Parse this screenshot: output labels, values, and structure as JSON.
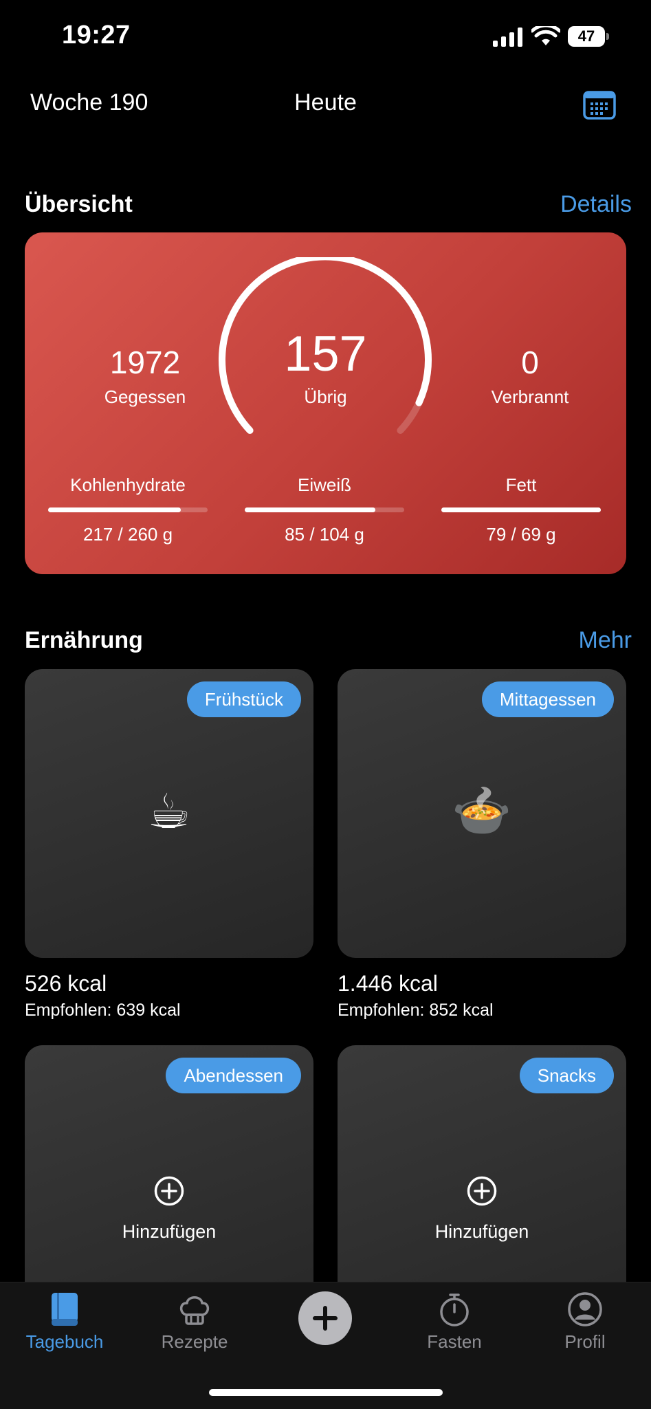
{
  "status_bar": {
    "time": "19:27",
    "battery": "47"
  },
  "header": {
    "week": "Woche 190",
    "title": "Heute",
    "calendar_icon": "calendar-icon"
  },
  "overview": {
    "title": "Übersicht",
    "link": "Details",
    "eaten_value": "1972",
    "eaten_label": "Gegessen",
    "remaining_value": "157",
    "remaining_label": "Übrig",
    "burned_value": "0",
    "burned_label": "Verbrannt",
    "ring_progress": 0.93,
    "macros": [
      {
        "label": "Kohlenhydrate",
        "value": "217 / 260 g",
        "progress": 0.83
      },
      {
        "label": "Eiweiß",
        "value": "85 / 104 g",
        "progress": 0.82
      },
      {
        "label": "Fett",
        "value": "79 / 69 g",
        "progress": 1.0
      }
    ],
    "card_colors": [
      "#d9574f",
      "#a72b28"
    ]
  },
  "nutrition": {
    "title": "Ernährung",
    "link": "Mehr",
    "meals": [
      {
        "tag": "Frühstück",
        "emoji": "☕",
        "kcal": "526 kcal",
        "recommended": "Empfohlen: 639 kcal"
      },
      {
        "tag": "Mittagessen",
        "emoji": "🍲",
        "kcal": "1.446 kcal",
        "recommended": "Empfohlen: 852 kcal"
      },
      {
        "tag": "Abendessen",
        "add_label": "Hinzufügen"
      },
      {
        "tag": "Snacks",
        "add_label": "Hinzufügen"
      }
    ]
  },
  "tabbar": {
    "items": [
      {
        "label": "Tagebuch",
        "icon": "book-icon",
        "active": true
      },
      {
        "label": "Rezepte",
        "icon": "chef-hat-icon",
        "active": false
      },
      {
        "label": "Fasten",
        "icon": "stopwatch-icon",
        "active": false
      },
      {
        "label": "Profil",
        "icon": "profile-icon",
        "active": false
      }
    ],
    "center_icon": "plus-icon"
  },
  "colors": {
    "accent": "#4a9be6",
    "background": "#000000",
    "card": "#2e2e2e"
  }
}
